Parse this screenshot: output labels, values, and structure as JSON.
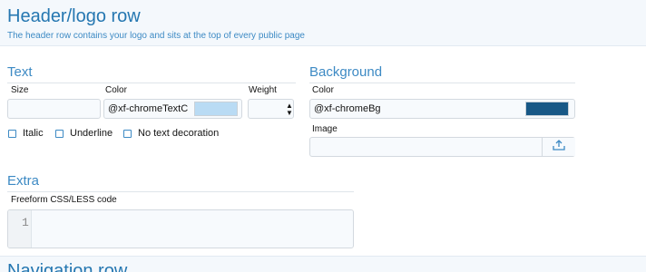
{
  "section": {
    "title": "Header/logo row",
    "description": "The header row contains your logo and sits at the top of every public page"
  },
  "text_group": {
    "title": "Text",
    "size_label": "Size",
    "size_value": "",
    "color_label": "Color",
    "color_value": "@xf-chromeTextC",
    "color_swatch": "#b9dbf4",
    "weight_label": "Weight",
    "weight_value": "",
    "checkboxes": [
      {
        "label": "Italic",
        "checked": false
      },
      {
        "label": "Underline",
        "checked": false
      },
      {
        "label": "No text decoration",
        "checked": false
      }
    ]
  },
  "background_group": {
    "title": "Background",
    "color_label": "Color",
    "color_value": "@xf-chromeBg",
    "color_swatch": "#185886",
    "image_label": "Image",
    "image_value": "",
    "upload_icon": "upload-icon"
  },
  "extra_group": {
    "title": "Extra",
    "code_label": "Freeform CSS/LESS code",
    "line_number": "1",
    "code_value": ""
  },
  "next_section": {
    "title": "Navigation row"
  },
  "colors": {
    "accent": "#2577b1",
    "heading": "#3d8ac4",
    "header_band": "#f4f8fc"
  }
}
